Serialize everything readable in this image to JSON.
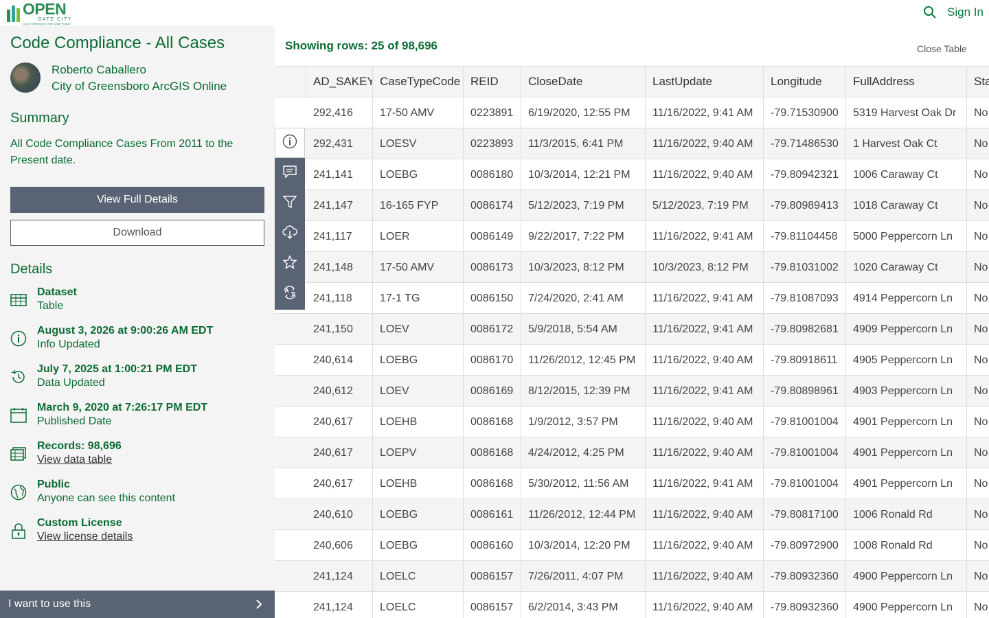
{
  "header": {
    "logo_text": "OPEN",
    "logo_sub": "GATE CITY",
    "logo_tag": "City of Greensboro Open Data Program",
    "sign_in": "Sign In"
  },
  "item": {
    "title": "Code Compliance - All Cases",
    "owner_name": "Roberto Caballero",
    "owner_org": "City of Greensboro ArcGIS Online",
    "summary_heading": "Summary",
    "summary": "All Code Compliance Cases From 2011 to the Present date.",
    "view_full_details": "View Full Details",
    "download": "Download",
    "details_heading": "Details",
    "details": [
      {
        "icon": "table-icon",
        "primary": "Dataset",
        "secondary": "Table",
        "link": false
      },
      {
        "icon": "info-icon",
        "primary": "August 3, 2026 at 9:00:26 AM EDT",
        "secondary": "Info Updated",
        "link": false
      },
      {
        "icon": "history-icon",
        "primary": "July 7, 2025 at 1:00:21 PM EDT",
        "secondary": "Data Updated",
        "link": false
      },
      {
        "icon": "calendar-icon",
        "primary": "March 9, 2020 at 7:26:17 PM EDT",
        "secondary": "Published Date",
        "link": false
      },
      {
        "icon": "records-icon",
        "primary": "Records: 98,696",
        "secondary": "View data table",
        "link": true
      },
      {
        "icon": "globe-icon",
        "primary": "Public",
        "secondary": "Anyone can see this content",
        "link": false
      },
      {
        "icon": "lock-icon",
        "primary": "Custom License",
        "secondary": "View license details",
        "link": true
      }
    ],
    "cta": "I want to use this"
  },
  "table": {
    "showing": "Showing rows: 25 of 98,696",
    "close": "Close Table",
    "columns": [
      "AD_SAKEY",
      "CaseTypeCode",
      "REID",
      "CloseDate",
      "LastUpdate",
      "Longitude",
      "FullAddress",
      "Sta"
    ],
    "rows": [
      [
        "292,416",
        "17-50 AMV",
        "0223891",
        "6/19/2020, 12:55 PM",
        "11/16/2022, 9:41 AM",
        "-79.71530900",
        "5319 Harvest Oak Dr",
        "No"
      ],
      [
        "292,431",
        "LOESV",
        "0223893",
        "11/3/2015, 6:41 PM",
        "11/16/2022, 9:40 AM",
        "-79.71486530",
        "1 Harvest Oak Ct",
        "No"
      ],
      [
        "241,141",
        "LOEBG",
        "0086180",
        "10/3/2014, 12:21 PM",
        "11/16/2022, 9:40 AM",
        "-79.80942321",
        "1006 Caraway Ct",
        "No"
      ],
      [
        "241,147",
        "16-165 FYP",
        "0086174",
        "5/12/2023, 7:19 PM",
        "5/12/2023, 7:19 PM",
        "-79.80989413",
        "1018 Caraway Ct",
        "No"
      ],
      [
        "241,117",
        "LOER",
        "0086149",
        "9/22/2017, 7:22 PM",
        "11/16/2022, 9:41 AM",
        "-79.81104458",
        "5000 Peppercorn Ln",
        "No"
      ],
      [
        "241,148",
        "17-50 AMV",
        "0086173",
        "10/3/2023, 8:12 PM",
        "10/3/2023, 8:12 PM",
        "-79.81031002",
        "1020 Caraway Ct",
        "No"
      ],
      [
        "241,118",
        "17-1 TG",
        "0086150",
        "7/24/2020, 2:41 AM",
        "11/16/2022, 9:41 AM",
        "-79.81087093",
        "4914 Peppercorn Ln",
        "No"
      ],
      [
        "241,150",
        "LOEV",
        "0086172",
        "5/9/2018, 5:54 AM",
        "11/16/2022, 9:41 AM",
        "-79.80982681",
        "4909 Peppercorn Ln",
        "No"
      ],
      [
        "240,614",
        "LOEBG",
        "0086170",
        "11/26/2012, 12:45 PM",
        "11/16/2022, 9:40 AM",
        "-79.80918611",
        "4905 Peppercorn Ln",
        "No"
      ],
      [
        "240,612",
        "LOEV",
        "0086169",
        "8/12/2015, 12:39 PM",
        "11/16/2022, 9:41 AM",
        "-79.80898961",
        "4903 Peppercorn Ln",
        "No"
      ],
      [
        "240,617",
        "LOEHB",
        "0086168",
        "1/9/2012, 3:57 PM",
        "11/16/2022, 9:40 AM",
        "-79.81001004",
        "4901 Peppercorn Ln",
        "No"
      ],
      [
        "240,617",
        "LOEPV",
        "0086168",
        "4/24/2012, 4:25 PM",
        "11/16/2022, 9:40 AM",
        "-79.81001004",
        "4901 Peppercorn Ln",
        "No"
      ],
      [
        "240,617",
        "LOEHB",
        "0086168",
        "5/30/2012, 11:56 AM",
        "11/16/2022, 9:41 AM",
        "-79.81001004",
        "4901 Peppercorn Ln",
        "No"
      ],
      [
        "240,610",
        "LOEBG",
        "0086161",
        "11/26/2012, 12:44 PM",
        "11/16/2022, 9:40 AM",
        "-79.80817100",
        "1006 Ronald Rd",
        "No"
      ],
      [
        "240,606",
        "LOEBG",
        "0086160",
        "10/3/2014, 12:20 PM",
        "11/16/2022, 9:40 AM",
        "-79.80972900",
        "1008 Ronald Rd",
        "No"
      ],
      [
        "241,124",
        "LOELC",
        "0086157",
        "7/26/2011, 4:07 PM",
        "11/16/2022, 9:40 AM",
        "-79.80932360",
        "4900 Peppercorn Ln",
        "No"
      ],
      [
        "241,124",
        "LOELC",
        "0086157",
        "6/2/2014, 3:43 PM",
        "11/16/2022, 9:40 AM",
        "-79.80932360",
        "4900 Peppercorn Ln",
        "No"
      ]
    ]
  },
  "toolbar": [
    "info-icon",
    "comment-icon",
    "filter-icon",
    "cloud-download-icon",
    "star-icon",
    "translate-icon"
  ],
  "colors": {
    "brand_green": "#0b6b33",
    "button_gray": "#5a6373",
    "panel_bg": "#f4f4f4"
  }
}
